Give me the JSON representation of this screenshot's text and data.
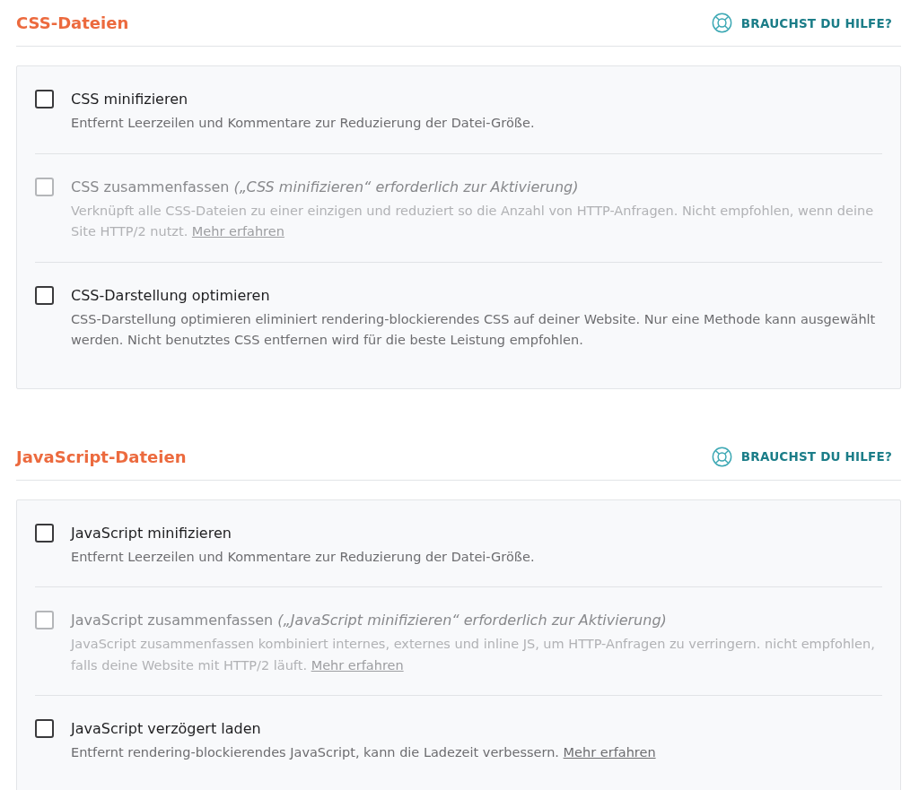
{
  "sections": [
    {
      "title": "CSS-Dateien",
      "help": {
        "label": "BRAUCHST DU HILFE?"
      },
      "options": [
        {
          "label": "CSS minifizieren",
          "description": "Entfernt Leerzeilen und Kommentare zur Reduzierung der Datei-Größe.",
          "checked": false,
          "disabled": false
        },
        {
          "label": "CSS zusammenfassen *(„CSS minifizieren“ erforderlich zur Aktivierung)*",
          "description": "Verknüpft alle CSS-Dateien zu einer einzigen und reduziert so die Anzahl von HTTP-Anfragen. Nicht empfohlen, wenn deine Site HTTP/2 nutzt.",
          "link": "Mehr erfahren",
          "checked": false,
          "disabled": true
        },
        {
          "label": "CSS-Darstellung optimieren",
          "description": "CSS-Darstellung optimieren eliminiert rendering-blockierendes CSS auf deiner Website. Nur eine Methode kann ausgewählt werden. Nicht benutztes CSS entfernen wird für die beste Leistung empfohlen.",
          "checked": false,
          "disabled": false
        }
      ]
    },
    {
      "title": "JavaScript-Dateien",
      "help": {
        "label": "BRAUCHST DU HILFE?"
      },
      "options": [
        {
          "label": "JavaScript minifizieren",
          "description": "Entfernt Leerzeilen und Kommentare zur Reduzierung der Datei-Größe.",
          "checked": false,
          "disabled": false
        },
        {
          "label": "JavaScript zusammenfassen *(„JavaScript minifizieren“ erforderlich zur Aktivierung)*",
          "description": "JavaScript zusammenfassen kombiniert internes, externes und inline JS, um HTTP-Anfragen zu verringern. nicht empfohlen, falls deine Website mit HTTP/2 läuft.",
          "link": "Mehr erfahren",
          "checked": false,
          "disabled": true
        },
        {
          "label": "JavaScript verzögert laden",
          "description": "Entfernt rendering-blockierendes JavaScript, kann die Ladezeit verbessern.",
          "link": "Mehr erfahren",
          "checked": false,
          "disabled": false
        }
      ]
    }
  ]
}
